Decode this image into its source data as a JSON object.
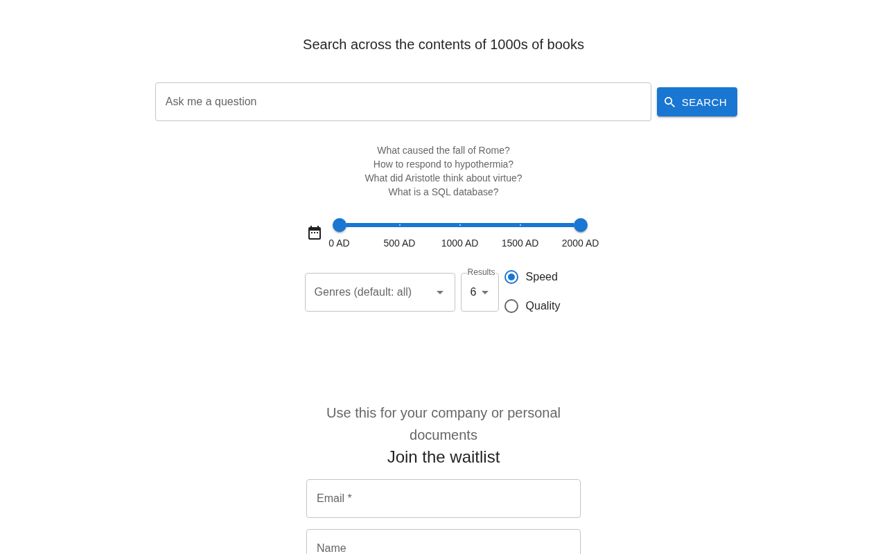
{
  "heading": "Search across the contents of 1000s of books",
  "search": {
    "placeholder": "Ask me a question",
    "button": "SEARCH"
  },
  "example_questions": [
    "What caused the fall of Rome?",
    "How to respond to hypothermia?",
    "What did Aristotle think about virtue?",
    "What is a SQL database?"
  ],
  "date_range": {
    "thumbs": [
      {
        "level": 0
      },
      {
        "level": 1
      }
    ],
    "marks": [
      "0 AD",
      "500 AD",
      "1000 AD",
      "1500 AD",
      "2000 AD"
    ]
  },
  "filters": {
    "genres": {
      "label": "Genres (default: all)"
    },
    "results": {
      "label": "Results",
      "value": "6"
    },
    "mode_options": [
      {
        "label": "Speed",
        "selected": true
      },
      {
        "label": "Quality",
        "selected": false
      }
    ]
  },
  "waitlist": {
    "tagline": "Use this for your company or personal documents",
    "title": "Join the waitlist",
    "fields": [
      {
        "placeholder": "Email *"
      },
      {
        "placeholder": "Name"
      }
    ]
  }
}
